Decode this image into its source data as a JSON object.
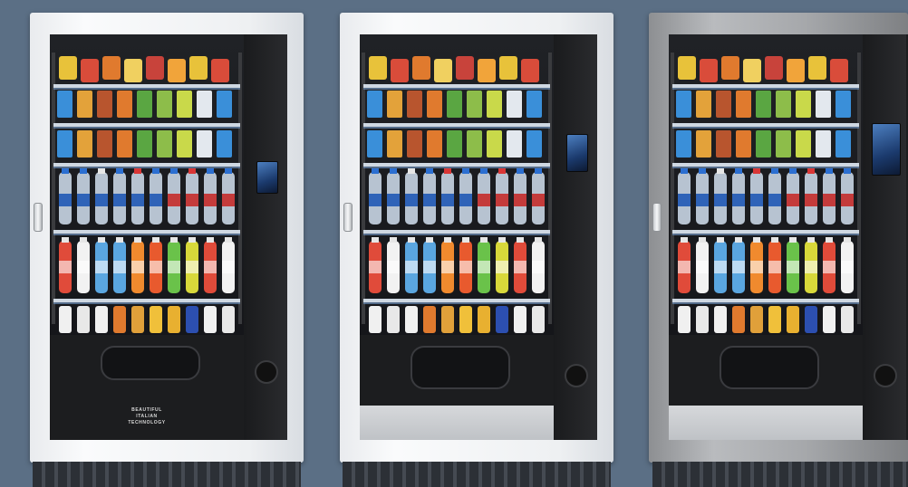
{
  "scene": {
    "description_label": "",
    "background": "#5b6f85"
  },
  "machines": [
    {
      "finish": "white",
      "front": "black-panel",
      "brand_lines": [
        "BEAUTIFUL",
        "ITALIAN",
        "TECHNOLOGY"
      ]
    },
    {
      "finish": "white",
      "front": "pickup-tray",
      "brand_lines": []
    },
    {
      "finish": "steel",
      "front": "pickup-tray",
      "brand_lines": []
    }
  ],
  "colors": {
    "cabinet": "#1c1d1f",
    "white_frame": "#f2f3f5",
    "steel_frame": "#a4a6a9",
    "screen": "#2f5fa3"
  }
}
